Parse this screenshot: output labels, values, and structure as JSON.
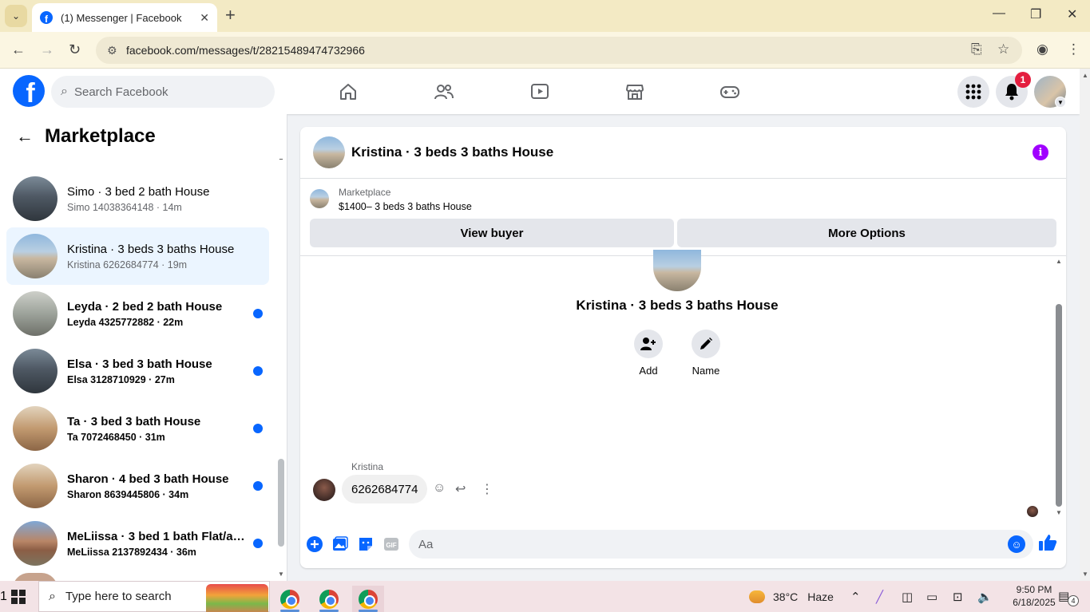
{
  "browser": {
    "tab_title": "(1) Messenger | Facebook",
    "url": "facebook.com/messages/t/28215489474732966"
  },
  "fb_header": {
    "search_placeholder": "Search Facebook",
    "notification_count": "1"
  },
  "sidebar": {
    "title": "Marketplace",
    "conversations": [
      {
        "name": "Simo · 3 bed 2 bath House",
        "sub": "Simo 14038364148 · 14m",
        "unread": false,
        "active": false
      },
      {
        "name": "Kristina · 3 beds 3 baths House",
        "sub": "Kristina 6262684774 · 19m",
        "unread": false,
        "active": true
      },
      {
        "name": "Leyda · 2 bed 2 bath House",
        "sub": "Leyda 4325772882 · 22m",
        "unread": true,
        "active": false
      },
      {
        "name": "Elsa · 3 bed 3 bath House",
        "sub": "Elsa 3128710929 · 27m",
        "unread": true,
        "active": false
      },
      {
        "name": "Ta · 3 bed 3 bath House",
        "sub": "Ta 7072468450 · 31m",
        "unread": true,
        "active": false
      },
      {
        "name": "Sharon · 4 bed 3 bath House",
        "sub": "Sharon 8639445806 · 34m",
        "unread": true,
        "active": false
      },
      {
        "name": "MeLiissa · 3 bed 1 bath Flat/ap...",
        "sub": "MeLiissa 2137892434 · 36m",
        "unread": true,
        "active": false
      }
    ]
  },
  "chat": {
    "title": "Kristina · 3 beds 3 baths House",
    "marketplace_label": "Marketplace",
    "listing": "$1400– 3 beds 3 baths House",
    "view_buyer": "View buyer",
    "more_options": "More Options",
    "profile_name": "Kristina · 3 beds 3 baths House",
    "action_add": "Add",
    "action_name": "Name",
    "sender": "Kristina",
    "message": "6262684774",
    "composer_placeholder": "Aa"
  },
  "taskbar": {
    "search_text": "Type here to search",
    "temperature": "38°C",
    "weather": "Haze",
    "weather_badge": "1",
    "time": "9:50 PM",
    "date": "6/18/2025",
    "notifications": "4"
  },
  "colors": {
    "fb_blue": "#0866ff",
    "unread_dot": "#0866ff",
    "active_row": "#ebf5ff",
    "info_purple": "#a000ff",
    "badge_red": "#e41e3f"
  }
}
